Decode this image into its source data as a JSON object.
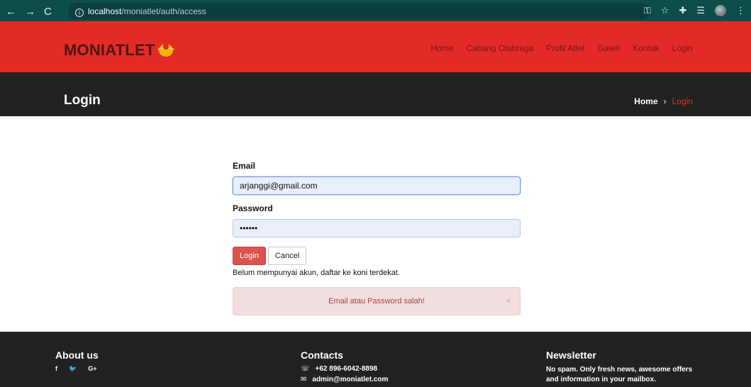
{
  "browser": {
    "url_host": "localhost",
    "url_path": "/moniatlet/auth/access",
    "info_icon": "i",
    "nav": {
      "back": "←",
      "forward": "→",
      "reload": "C"
    }
  },
  "site": {
    "logo_text": "MONIATLET",
    "menu": [
      "Home",
      "Cabang Olahraga",
      "Profil Atlet",
      "Galeri",
      "Kontak",
      "Login"
    ]
  },
  "page": {
    "title": "Login",
    "breadcrumb_home": "Home",
    "breadcrumb_sep": "›",
    "breadcrumb_current": "Login"
  },
  "form": {
    "email_label": "Email",
    "email_value": "arjanggi@gmail.com",
    "password_label": "Password",
    "password_value": "••••••",
    "login_button": "Login",
    "cancel_button": "Cancel",
    "register_note": "Belum mempunyai akun, daftar ke koni terdekat.",
    "alert_text": "Email atau Password salah!",
    "alert_close": "×"
  },
  "footer": {
    "about_title": "About us",
    "social": [
      "f",
      "🐦",
      "G+"
    ],
    "contacts_title": "Contacts",
    "phone": "+62 896-6042-8898",
    "email": "admin@moniatlet.com",
    "newsletter_title": "Newsletter",
    "newsletter_text": "No spam. Only fresh news, awesome offers and information in your mailbox."
  },
  "colors": {
    "header_red": "#e32a27",
    "title_bar": "#222222",
    "chrome_teal": "#0d4d4a",
    "login_button": "#d9534f",
    "alert_bg": "#f2dede"
  }
}
